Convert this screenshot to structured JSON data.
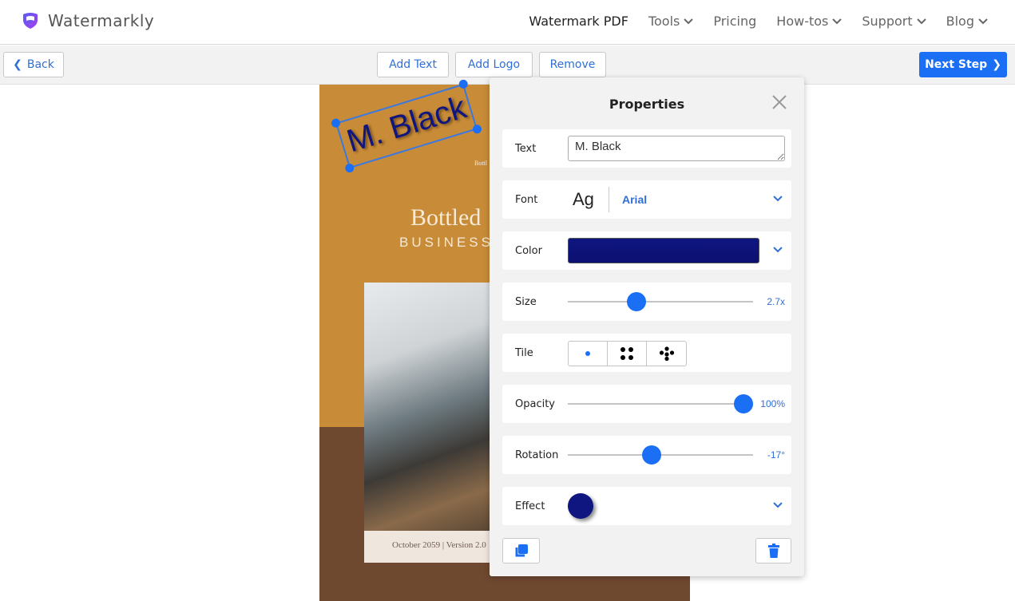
{
  "brand": {
    "name": "Watermarkly"
  },
  "nav": {
    "items": [
      {
        "label": "Watermark PDF",
        "dropdown": false
      },
      {
        "label": "Tools",
        "dropdown": true
      },
      {
        "label": "Pricing",
        "dropdown": false
      },
      {
        "label": "How-tos",
        "dropdown": true
      },
      {
        "label": "Support",
        "dropdown": true
      },
      {
        "label": "Blog",
        "dropdown": true
      }
    ]
  },
  "toolbar": {
    "back": "Back",
    "add_text": "Add Text",
    "add_logo": "Add Logo",
    "remove": "Remove",
    "next": "Next Step"
  },
  "document": {
    "small_text": "Bottl",
    "title": "Bottled",
    "subtitle": "BUSINESS",
    "caption": "October 2059 | Version 2.0"
  },
  "watermark": {
    "text": "M. Black",
    "rotation_deg": -17,
    "color": "#0f1680"
  },
  "panel": {
    "title": "Properties",
    "text": {
      "label": "Text",
      "value": "M. Black"
    },
    "font": {
      "label": "Font",
      "preview": "Ag",
      "value": "Arial"
    },
    "color": {
      "label": "Color",
      "value": "#0f1680"
    },
    "size": {
      "label": "Size",
      "display": "2.7x",
      "level": 0.37
    },
    "tile": {
      "label": "Tile",
      "options": [
        "single",
        "grid-4",
        "grid-5"
      ],
      "selected": "single"
    },
    "opacity": {
      "label": "Opacity",
      "display": "100%",
      "level": 1.0
    },
    "rotation": {
      "label": "Rotation",
      "display": "-17°",
      "value": -17,
      "min": -180,
      "max": 180
    },
    "effect": {
      "label": "Effect",
      "value": "shadow"
    }
  },
  "colors": {
    "accent": "#1a6ff5",
    "doc_top": "#c88b37",
    "doc_bottom": "#6f4830"
  }
}
